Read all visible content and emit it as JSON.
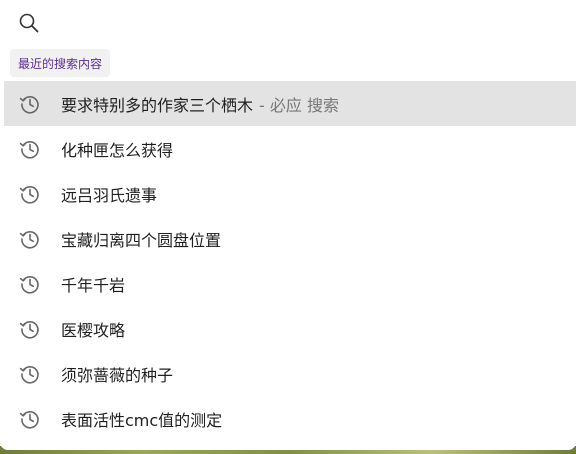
{
  "search": {
    "placeholder": "",
    "value": "",
    "icon": "search-icon"
  },
  "section": {
    "title": "最近的搜索内容"
  },
  "history": [
    {
      "text": "要求特别多的作家三个栖木",
      "suffix": "- 必应 搜索",
      "selected": true,
      "icon": "history-icon"
    },
    {
      "text": "化种匣怎么获得",
      "icon": "history-icon"
    },
    {
      "text": "远吕羽氏遗事",
      "icon": "history-icon"
    },
    {
      "text": "宝藏归离四个圆盘位置",
      "icon": "history-icon"
    },
    {
      "text": "千年千岩",
      "icon": "history-icon"
    },
    {
      "text": "医樱攻略",
      "icon": "history-icon"
    },
    {
      "text": "须弥蔷薇的种子",
      "icon": "history-icon"
    },
    {
      "text": "表面活性cmc值的测定",
      "icon": "history-icon"
    }
  ],
  "colors": {
    "selected_bg": "#e3e3e3",
    "section_text": "#5c2d91",
    "suffix_text": "#777777"
  }
}
